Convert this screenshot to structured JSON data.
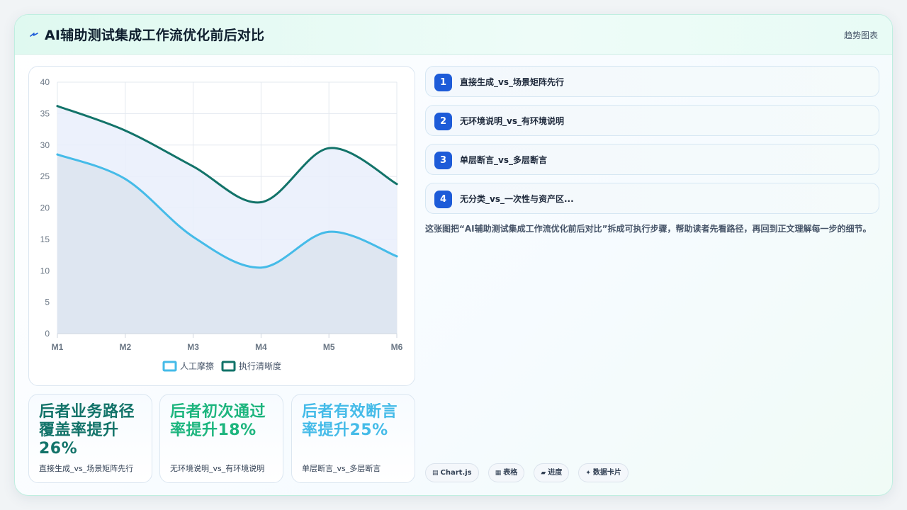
{
  "header": {
    "title": "AI辅助测试集成工作流优化前后对比",
    "tag": "趋势图表",
    "icon": "bolt-icon"
  },
  "chart_data": {
    "type": "area",
    "categories": [
      "M1",
      "M2",
      "M3",
      "M4",
      "M5",
      "M6"
    ],
    "ylim": [
      0,
      40
    ],
    "yticks": [
      0,
      5,
      10,
      15,
      20,
      25,
      30,
      35,
      40
    ],
    "grid": true,
    "legend_position": "bottom",
    "series": [
      {
        "name": "执行清晰度",
        "values": [
          36.2,
          32.3,
          26.6,
          20.9,
          29.5,
          23.8
        ],
        "color": "#127369",
        "fill": "#e9effc"
      },
      {
        "name": "人工摩擦",
        "values": [
          28.5,
          24.6,
          15.4,
          10.5,
          16.2,
          12.3
        ],
        "color": "#45bbe8",
        "fill": "#dce4ef"
      }
    ]
  },
  "stats": [
    {
      "title": "后者业务路径覆盖率提升26%",
      "sub": "直接生成_vs_场景矩阵先行",
      "color": "#127369"
    },
    {
      "title": "后者初次通过率提升18%",
      "sub": "无环境说明_vs_有环境说明",
      "color": "#1db57e"
    },
    {
      "title": "后者有效断言率提升25%",
      "sub": "单层断言_vs_多层断言",
      "color": "#45bbe8"
    }
  ],
  "steps": [
    {
      "num": "1",
      "label": "直接生成_vs_场景矩阵先行"
    },
    {
      "num": "2",
      "label": "无环境说明_vs_有环境说明"
    },
    {
      "num": "3",
      "label": "单层断言_vs_多层断言"
    },
    {
      "num": "4",
      "label": "无分类_vs_一次性与资产区..."
    }
  ],
  "description": "这张图把“AI辅助测试集成工作流优化前后对比”拆成可执行步骤，帮助读者先看路径，再回到正文理解每一步的细节。",
  "tools": [
    {
      "icon": "▤",
      "label": "Chart.js"
    },
    {
      "icon": "▦",
      "label": "表格"
    },
    {
      "icon": "▰",
      "label": "进度"
    },
    {
      "icon": "✦",
      "label": "数据卡片"
    }
  ]
}
